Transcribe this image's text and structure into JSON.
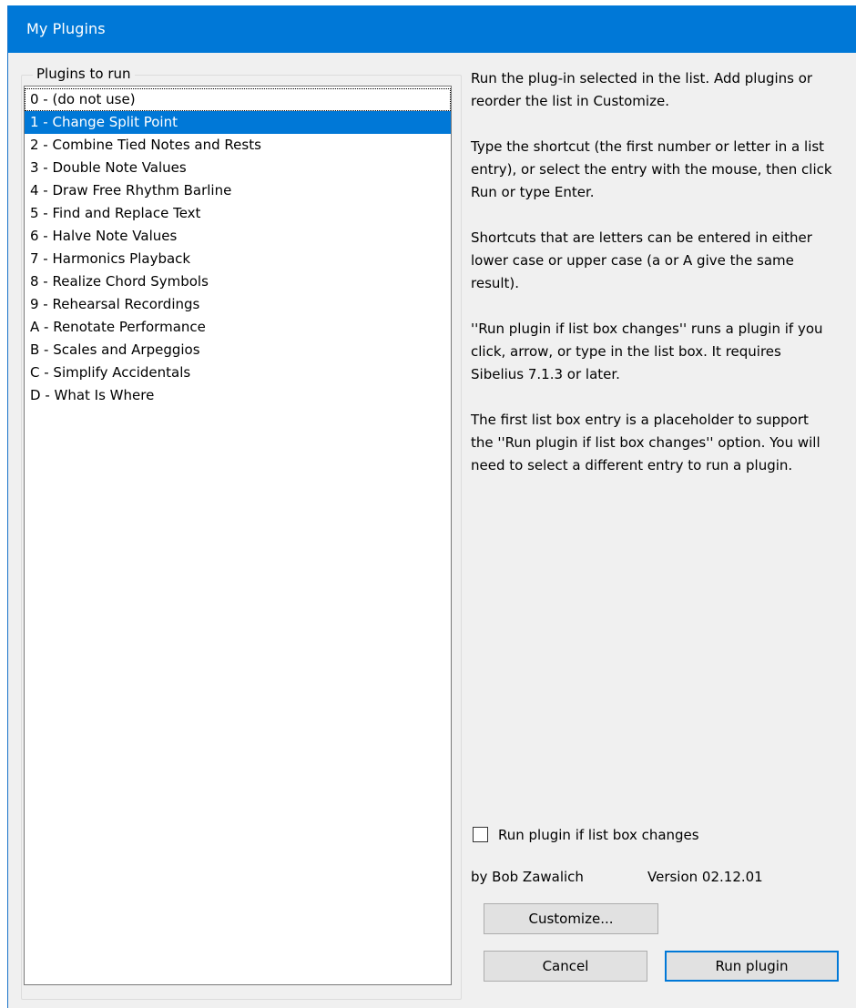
{
  "window": {
    "title": "My Plugins"
  },
  "group": {
    "label": "Plugins to run"
  },
  "list": {
    "items": [
      "0 - (do not use)",
      "1 - Change Split Point",
      "2 - Combine Tied Notes and Rests",
      "3 - Double Note Values",
      "4 - Draw Free Rhythm Barline",
      "5 - Find and Replace Text",
      "6 - Halve Note Values",
      "7 - Harmonics Playback",
      "8 - Realize Chord Symbols",
      "9 - Rehearsal Recordings",
      "A - Renotate Performance",
      "B - Scales and Arpeggios",
      "C - Simplify Accidentals",
      "D - What Is Where"
    ],
    "selected_index": 1,
    "focused_index": 0
  },
  "help": {
    "paragraphs": [
      "Run the  plug-in selected in the list. Add plugins or reorder the list in Customize.",
      "Type the shortcut (the first number or letter in a list entry), or select the entry with the mouse, then click Run or type Enter.",
      "Shortcuts that are letters can be entered in either lower case or upper case (a or A give the same result).",
      "''Run plugin if list box changes'' runs a plugin if you click, arrow, or type in the list box. It requires Sibelius 7.1.3 or later.",
      "The first list box entry is a placeholder to support the ''Run plugin if list box changes'' option. You will need to select a different entry to run a plugin."
    ]
  },
  "options": {
    "run_on_change_label": "Run plugin if list box changes",
    "run_on_change_checked": false
  },
  "footer": {
    "author": "by Bob Zawalich",
    "version": "Version 02.12.01"
  },
  "buttons": {
    "customize": "Customize...",
    "cancel": "Cancel",
    "run": "Run plugin"
  },
  "colors": {
    "titlebar": "#0078d7",
    "selection": "#0078d7",
    "dialog_bg": "#f0f0f0"
  }
}
